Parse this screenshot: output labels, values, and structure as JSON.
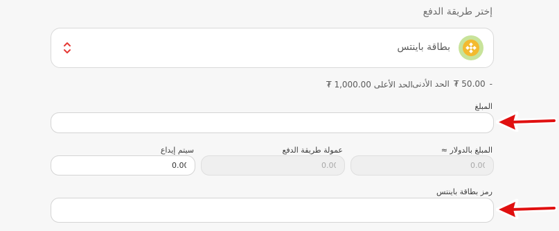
{
  "payment": {
    "section_title": "إختر طريقة الدفع",
    "method": {
      "label": "بطاقة باينتس",
      "logo_icon": "binance-icon",
      "selector_icon": "sort-updown-icon",
      "accent_color": "#e53935"
    },
    "limits": {
      "min_label": "الحد الأدنى",
      "min_value": "50.00 ₮",
      "separator": "-",
      "max_text": "الحد الأعلى 1,000.00 ₮"
    }
  },
  "form": {
    "amount": {
      "label": "المبلغ",
      "value": "",
      "placeholder": ""
    },
    "usd_amount": {
      "label": "المبلغ بالدولار ≈",
      "value": "0.00"
    },
    "method_fee": {
      "label": "عمولة طريقة الدفع",
      "value": "0.00"
    },
    "deposit_system": {
      "label": "سيتم إيداع",
      "value": "0.00"
    },
    "card_code": {
      "label": "رمز بطاقة باينتس",
      "value": "",
      "placeholder": ""
    }
  },
  "annotations": {
    "arrow_color": "#e01010",
    "arrow_icon": "red-arrow-pointing-left"
  }
}
